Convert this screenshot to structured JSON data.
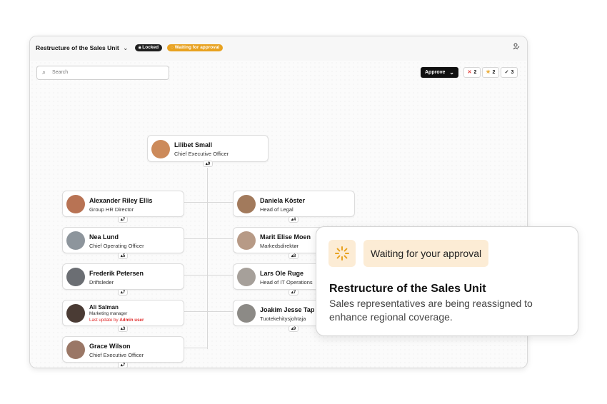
{
  "window": {
    "title": "Restructure of the Sales Unit",
    "chevron_icon": "chevron-down-icon",
    "locked_badge": "Locked",
    "waiting_badge": "Waiting for approval",
    "user_icon": "user-icon"
  },
  "toolbar": {
    "search_placeholder": "Search",
    "approve_label": "Approve",
    "counters": [
      {
        "icon": "x-icon",
        "glyph": "✕",
        "color": "#e0342f",
        "value": "2"
      },
      {
        "icon": "loading-icon",
        "glyph": "✳",
        "color": "#e8a220",
        "value": "2"
      },
      {
        "icon": "check-icon",
        "glyph": "✓",
        "color": "#2b2b2b",
        "value": "3"
      }
    ]
  },
  "nodes": {
    "ceo": {
      "name": "Lilibet Small",
      "role": "Chief Executive Officer",
      "reports": "9"
    },
    "left": [
      {
        "name": "Alexander Riley Ellis",
        "role": "Group HR Director",
        "reports": "7"
      },
      {
        "name": "Nea Lund",
        "role": "Chief Operating Officer",
        "reports": "5"
      },
      {
        "name": "Frederik Petersen",
        "role": "Driftsleder",
        "reports": "7"
      },
      {
        "name": "Ali Salman",
        "role": "Marketing manager",
        "update_prefix": "Last update by",
        "update_user": "Admin user",
        "reports": "3"
      },
      {
        "name": "Grace Wilson",
        "role": "Chief Executive Officer",
        "reports": "7"
      }
    ],
    "right": [
      {
        "name": "Daniela Köster",
        "role": "Head of Legal",
        "reports": "4"
      },
      {
        "name": "Marit Elise Moen",
        "role": "Markedsdirektør",
        "reports": "8"
      },
      {
        "name": "Lars Ole Ruge",
        "role": "Head of IT Operations",
        "reports": "7"
      },
      {
        "name": "Joakim Jesse Tap",
        "role": "Tuotekehitysjohtaja",
        "reports": "9"
      }
    ],
    "chevron_up": "▴"
  },
  "popup": {
    "icon": "spinner-icon",
    "badge": "Waiting for your approval",
    "title": "Restructure of the Sales Unit",
    "description": "Sales representatives are being reassigned to enhance regional coverage."
  },
  "colors": {
    "accent": "#e8a220",
    "popup_bg": "#fcecd5",
    "danger": "#e0342f"
  }
}
